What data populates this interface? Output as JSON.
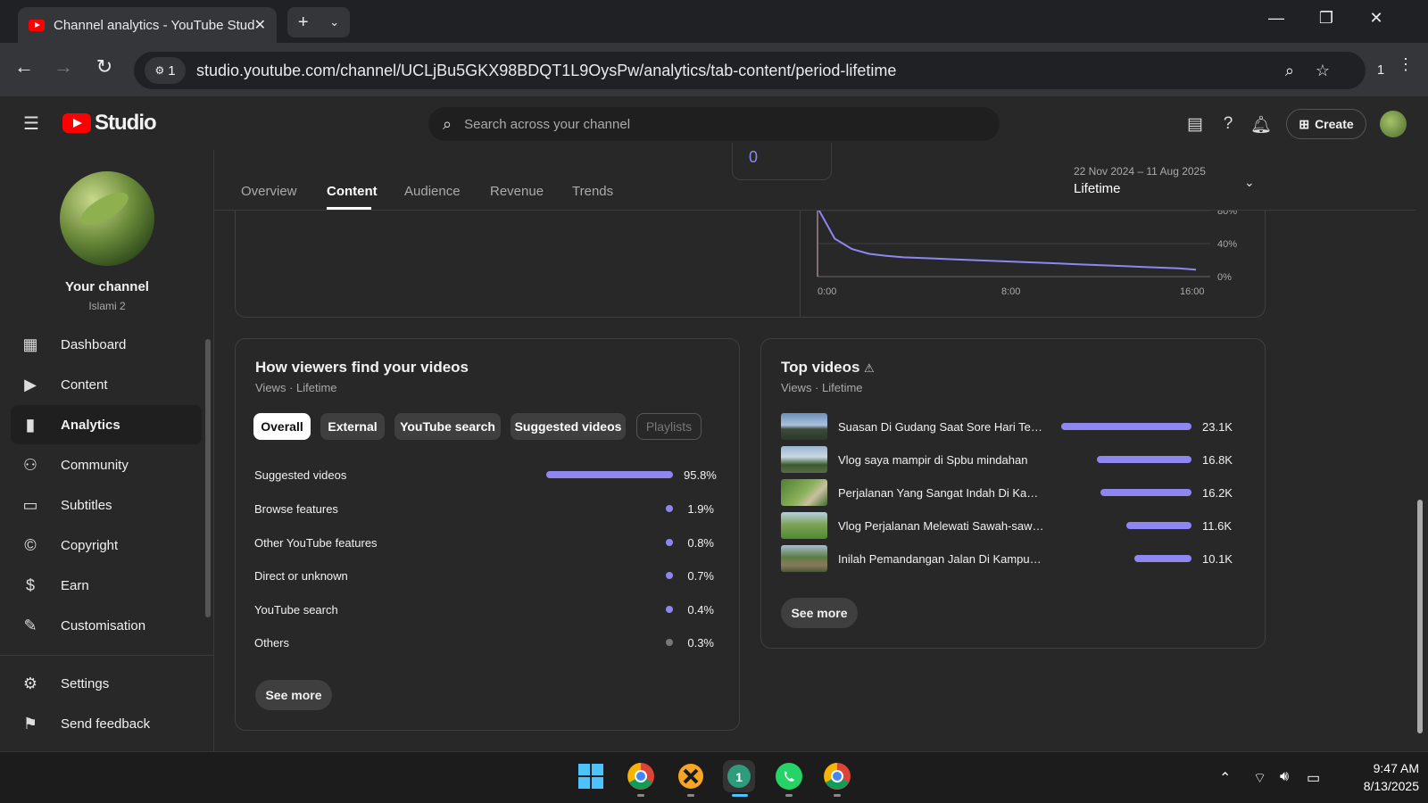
{
  "browser": {
    "tab_title": "Channel analytics - YouTube Studio",
    "url": "studio.youtube.com/channel/UCLjBu5GKX98BDQT1L9OysPw/analytics/tab-content/period-lifetime",
    "site_badge": "1",
    "extension_count": "1"
  },
  "header": {
    "logo_text": "Studio",
    "search_placeholder": "Search across your channel",
    "create_label": "Create"
  },
  "channel": {
    "name": "Your channel",
    "subtitle": "Islami 2"
  },
  "sidebar": {
    "items": [
      {
        "label": "Dashboard",
        "icon": "dashboard-icon"
      },
      {
        "label": "Content",
        "icon": "content-icon"
      },
      {
        "label": "Analytics",
        "icon": "analytics-icon",
        "active": true
      },
      {
        "label": "Community",
        "icon": "community-icon"
      },
      {
        "label": "Subtitles",
        "icon": "subtitles-icon"
      },
      {
        "label": "Copyright",
        "icon": "copyright-icon"
      },
      {
        "label": "Earn",
        "icon": "earn-icon"
      },
      {
        "label": "Customisation",
        "icon": "customisation-icon"
      }
    ],
    "bottom": [
      {
        "label": "Settings",
        "icon": "settings-icon"
      },
      {
        "label": "Send feedback",
        "icon": "feedback-icon"
      }
    ]
  },
  "tabs": [
    "Overview",
    "Content",
    "Audience",
    "Revenue",
    "Trends"
  ],
  "active_tab": "Content",
  "date": {
    "range": "22 Nov 2024 – 11 Aug 2025",
    "value": "Lifetime"
  },
  "retention_chart": {
    "partial_value": "0",
    "chart_data": {
      "type": "line",
      "x_ticks": [
        "0:00",
        "8:00",
        "16:00"
      ],
      "y_ticks": [
        "80%",
        "40%",
        "0%"
      ],
      "series": [
        {
          "values": [
            100,
            55,
            40,
            33,
            30,
            28,
            27,
            26,
            25,
            24,
            23,
            22,
            21,
            20,
            19,
            18,
            17,
            16,
            15,
            14,
            13,
            12,
            10
          ]
        }
      ]
    }
  },
  "traffic": {
    "title": "How viewers find your videos",
    "subtitle": "Views · Lifetime",
    "chips": [
      "Overall",
      "External",
      "YouTube search",
      "Suggested videos",
      "Playlists"
    ],
    "rows": [
      {
        "label": "Suggested videos",
        "pct": "95.8%",
        "value": 95.8
      },
      {
        "label": "Browse features",
        "pct": "1.9%",
        "value": 1.9
      },
      {
        "label": "Other YouTube features",
        "pct": "0.8%",
        "value": 0.8
      },
      {
        "label": "Direct or unknown",
        "pct": "0.7%",
        "value": 0.7
      },
      {
        "label": "YouTube search",
        "pct": "0.4%",
        "value": 0.4
      },
      {
        "label": "Others",
        "pct": "0.3%",
        "value": 0.3
      }
    ],
    "see_more": "See more"
  },
  "top_videos": {
    "title": "Top videos",
    "subtitle": "Views · Lifetime",
    "rows": [
      {
        "title": "Suasan Di Gudang Saat Sore Hari Terasa ...",
        "views": "23.1K",
        "value": 23.1
      },
      {
        "title": "Vlog saya mampir di Spbu mindahan",
        "views": "16.8K",
        "value": 16.8
      },
      {
        "title": "Perjalanan Yang Sangat Indah Di Kampu...",
        "views": "16.2K",
        "value": 16.2
      },
      {
        "title": "Vlog Perjalanan Melewati Sawah-sawah ...",
        "views": "11.6K",
        "value": 11.6
      },
      {
        "title": "Inilah Pemandangan Jalan Di Kampung ...",
        "views": "10.1K",
        "value": 10.1
      }
    ],
    "see_more": "See more"
  },
  "taskbar": {
    "time": "9:47 AM",
    "date": "8/13/2025"
  },
  "colors": {
    "accent": "#8f87f1",
    "brand": "#ff0000"
  }
}
